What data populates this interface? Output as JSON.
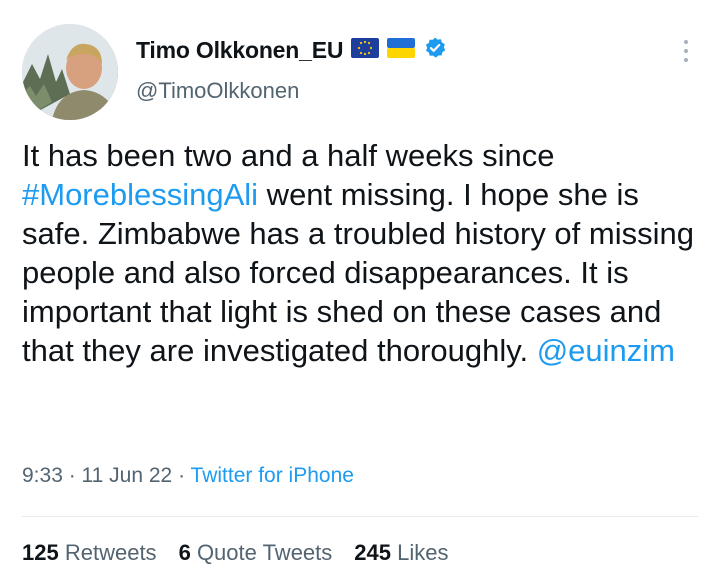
{
  "author": {
    "display_name": "Timo Olkkonen_EU",
    "handle": "@TimoOlkkonen",
    "verified": true,
    "flags": [
      "eu-flag-icon",
      "ukraine-flag-icon"
    ]
  },
  "tweet": {
    "text_before": "It has been two and a half weeks since ",
    "hashtag": "#MoreblessingAli",
    "text_after": " went missing. I hope she is safe. Zimbabwe has a troubled history of missing people and also forced disappearances. It is important that light is shed on these cases and that they are investigated thoroughly. ",
    "mention": "@euinzim"
  },
  "meta": {
    "time": "9:33",
    "sep1": " · ",
    "date": "11 Jun 22",
    "sep2": " · ",
    "source": "Twitter for iPhone"
  },
  "stats": {
    "retweets_count": "125",
    "retweets_label": "Retweets",
    "quotes_count": "6",
    "quotes_label": "Quote Tweets",
    "likes_count": "245",
    "likes_label": "Likes"
  },
  "colors": {
    "link": "#1d9bf0",
    "text": "#0f1419",
    "secondary": "#536471"
  }
}
